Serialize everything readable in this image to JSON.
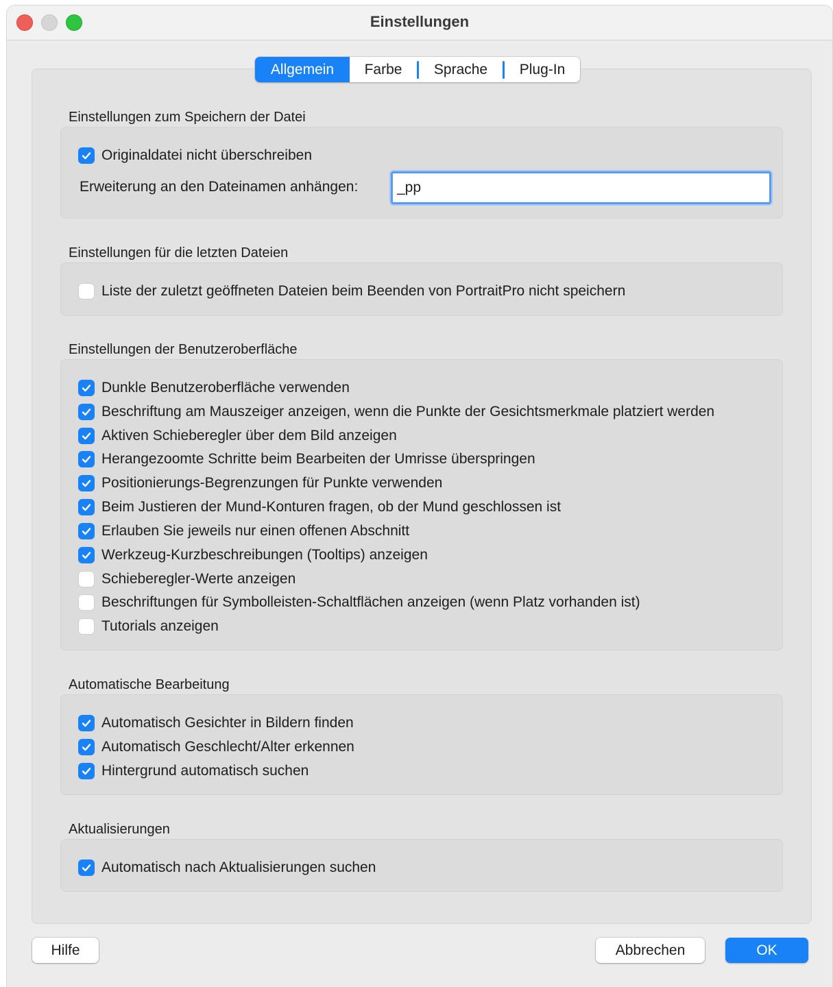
{
  "window": {
    "title": "Einstellungen"
  },
  "tabs": [
    {
      "label": "Allgemein",
      "active": true
    },
    {
      "label": "Farbe",
      "active": false
    },
    {
      "label": "Sprache",
      "active": false
    },
    {
      "label": "Plug-In",
      "active": false
    }
  ],
  "sections": {
    "save": {
      "title": "Einstellungen zum Speichern der Datei",
      "options": [
        {
          "label": "Originaldatei nicht überschreiben",
          "checked": true
        }
      ],
      "extension_label": "Erweiterung an den Dateinamen anhängen:",
      "extension_value": "_pp"
    },
    "recent": {
      "title": "Einstellungen für die letzten Dateien",
      "options": [
        {
          "label": "Liste der zuletzt geöffneten Dateien beim Beenden von PortraitPro nicht speichern",
          "checked": false
        }
      ]
    },
    "ui": {
      "title": "Einstellungen der Benutzeroberfläche",
      "options": [
        {
          "label": "Dunkle Benutzeroberfläche verwenden",
          "checked": true
        },
        {
          "label": "Beschriftung am Mauszeiger anzeigen, wenn die Punkte der Gesichtsmerkmale platziert werden",
          "checked": true
        },
        {
          "label": "Aktiven Schieberegler über dem Bild anzeigen",
          "checked": true
        },
        {
          "label": "Herangezoomte Schritte beim Bearbeiten der Umrisse überspringen",
          "checked": true
        },
        {
          "label": "Positionierungs-Begrenzungen für Punkte verwenden",
          "checked": true
        },
        {
          "label": "Beim Justieren der Mund-Konturen fragen, ob der Mund geschlossen ist",
          "checked": true
        },
        {
          "label": "Erlauben Sie jeweils nur einen offenen Abschnitt",
          "checked": true
        },
        {
          "label": "Werkzeug-Kurzbeschreibungen (Tooltips) anzeigen",
          "checked": true
        },
        {
          "label": "Schieberegler-Werte anzeigen",
          "checked": false
        },
        {
          "label": "Beschriftungen für Symbolleisten-Schaltflächen anzeigen (wenn Platz vorhanden ist)",
          "checked": false
        },
        {
          "label": "Tutorials anzeigen",
          "checked": false
        }
      ]
    },
    "auto": {
      "title": "Automatische Bearbeitung",
      "options": [
        {
          "label": "Automatisch Gesichter in Bildern finden",
          "checked": true
        },
        {
          "label": "Automatisch Geschlecht/Alter erkennen",
          "checked": true
        },
        {
          "label": "Hintergrund automatisch suchen",
          "checked": true
        }
      ]
    },
    "updates": {
      "title": "Aktualisierungen",
      "options": [
        {
          "label": "Automatisch nach Aktualisierungen suchen",
          "checked": true
        }
      ]
    }
  },
  "buttons": {
    "help": "Hilfe",
    "cancel": "Abbrechen",
    "ok": "OK"
  },
  "colors": {
    "accent": "#1a82f7",
    "close": "#ee5f57",
    "zoom": "#2fc540"
  }
}
